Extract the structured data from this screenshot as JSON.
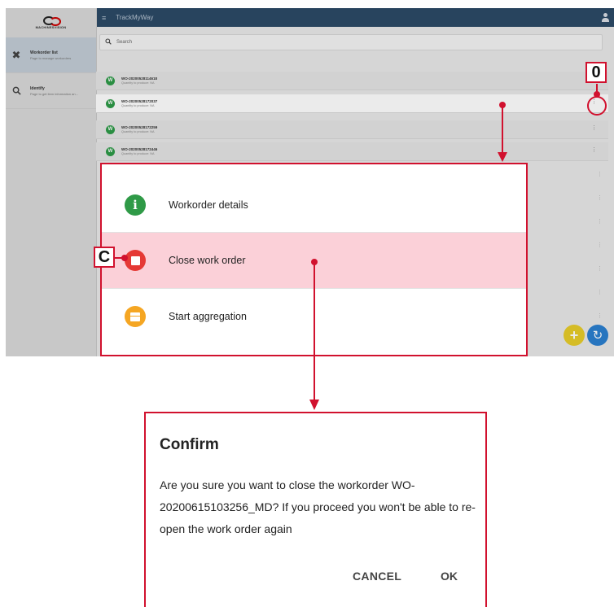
{
  "app": {
    "logo_text": "MACHINESVISION",
    "header_title": "TrackMyWay",
    "sidebar": {
      "items": [
        {
          "title": "Workorder list",
          "subtitle": "Page to manage workorders",
          "icon": "tools-icon"
        },
        {
          "title": "Identify",
          "subtitle": "Page to get item information an...",
          "icon": "search-icon"
        }
      ]
    },
    "search": {
      "placeholder": "Search"
    },
    "workorders": [
      {
        "avatar": "W",
        "id": "WO-20200528114618",
        "subtitle": "Quantity to produce: NA"
      },
      {
        "avatar": "W",
        "id": "WO-20200528172037",
        "subtitle": "Quantity to produce: NA"
      },
      {
        "avatar": "W",
        "id": "WO-20200528172259",
        "subtitle": "Quantity to produce: NA"
      },
      {
        "avatar": "W",
        "id": "WO-20200528172446",
        "subtitle": "Quantity to produce: NA"
      }
    ],
    "kebab_glyph": "⋮",
    "fab_add": "+",
    "fab_refresh": "↻"
  },
  "action_sheet": {
    "items": [
      {
        "label": "Workorder details",
        "icon": "info-icon",
        "color": "#2f9a47"
      },
      {
        "label": "Close work order",
        "icon": "stop-icon",
        "color": "#e53935"
      },
      {
        "label": "Start aggregation",
        "icon": "box-icon",
        "color": "#f5a623"
      }
    ],
    "selected_index": 1
  },
  "confirm_dialog": {
    "title": "Confirm",
    "message": "Are you sure you want to close the workorder WO-20200615103256_MD? If you proceed you won't be able to re-open the work order again",
    "cancel_label": "CANCEL",
    "ok_label": "OK"
  },
  "annotations": {
    "label_0": "0",
    "label_c": "C",
    "color": "#d1112e"
  }
}
